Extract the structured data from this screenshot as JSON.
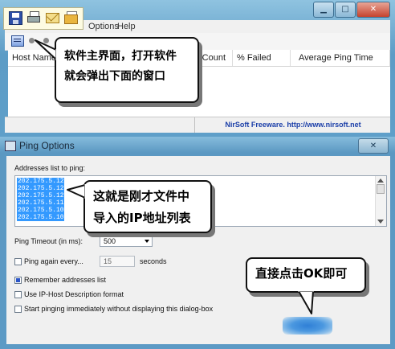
{
  "main_window": {
    "menu": {
      "options": "Options",
      "help": "Help"
    },
    "columns": [
      "Host Name",
      "Count",
      "% Failed",
      "Average Ping Time"
    ],
    "status_link": "NirSoft Freeware.  http://www.nirsoft.net"
  },
  "dialog": {
    "title": "Ping Options",
    "addresses_label": "Addresses list to ping:",
    "addresses": [
      "202.175.5.121",
      "202.175.5.120",
      "202.175.5.120",
      "202.175.5.114",
      "202.175.5.106",
      "202.175.5.104"
    ],
    "ping_timeout_label": "Ping Timeout (in ms):",
    "ping_timeout_value": "500",
    "ping_again_label": "Ping again every...",
    "ping_again_value": "15",
    "seconds_label": "seconds",
    "remember_label": "Remember addresses list",
    "remember_checked": true,
    "use_ip_host_label": "Use IP-Host Description format",
    "start_immediately_label": "Start pinging immediately without displaying this dialog-box"
  },
  "annotations": {
    "callout_main_line1": "软件主界面，打开软件",
    "callout_main_line2": "就会弹出下面的窗口",
    "callout_list_line1": "这就是刚才文件中",
    "callout_list_line2": "导入的IP地址列表",
    "callout_ok": "直接点击OK即可"
  },
  "icons": {
    "quick_toolbar": [
      "save-icon",
      "print-icon",
      "mail-icon",
      "folder-icon"
    ],
    "dialog_close": "close-icon"
  },
  "colors": {
    "aero_blue": "#5c9ac5",
    "selection_blue": "#3399ff",
    "status_link": "#1a3ea8"
  }
}
